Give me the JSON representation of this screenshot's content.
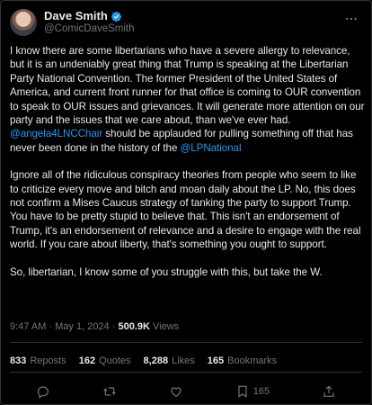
{
  "author": {
    "name": "Dave Smith",
    "handle": "@ComicDaveSmith",
    "verified_icon": "verified-badge-icon"
  },
  "tweet": {
    "p1_a": "I know there are some libertarians who have a severe allergy to relevance, but it is an undeniably great thing that Trump is speaking at the Libertarian Party National Convention. The former President of the United States of America, and current front runner for that office is coming to OUR convention to speak to OUR issues and grievances. It will generate more attention on our party and the issues that we care about, than we've ever had. ",
    "mention1": "@angela4LNCChair",
    "p1_b": " should be applauded for pulling something off that has never been done in the history of the ",
    "mention2": "@LPNational",
    "p2": "Ignore all of the ridiculous conspiracy theories from people who seem to like to criticize every move and bitch and moan daily about the LP. No, this does not confirm a Mises Caucus strategy of tanking the party to support Trump. You have to be pretty stupid to believe that. This isn't an endorsement of Trump, it's an endorsement of relevance and a desire to engage with the real world. If you care about liberty, that's something you ought to support.",
    "p3": "So, libertarian, I know some of you struggle with this, but take the W."
  },
  "meta": {
    "timestamp": "9:47 AM · May 1, 2024 · ",
    "views_count": "500.9K",
    "views_label": " Views"
  },
  "stats": {
    "reposts_count": "833",
    "reposts_label": "Reposts",
    "quotes_count": "162",
    "quotes_label": "Quotes",
    "likes_count": "8,288",
    "likes_label": "Likes",
    "bookmarks_count": "165",
    "bookmarks_label": "Bookmarks"
  },
  "actions": {
    "bookmark_count": "165"
  },
  "colors": {
    "background": "#000000",
    "text": "#e7e9ea",
    "muted": "#71767b",
    "accent": "#1d9bf0"
  }
}
